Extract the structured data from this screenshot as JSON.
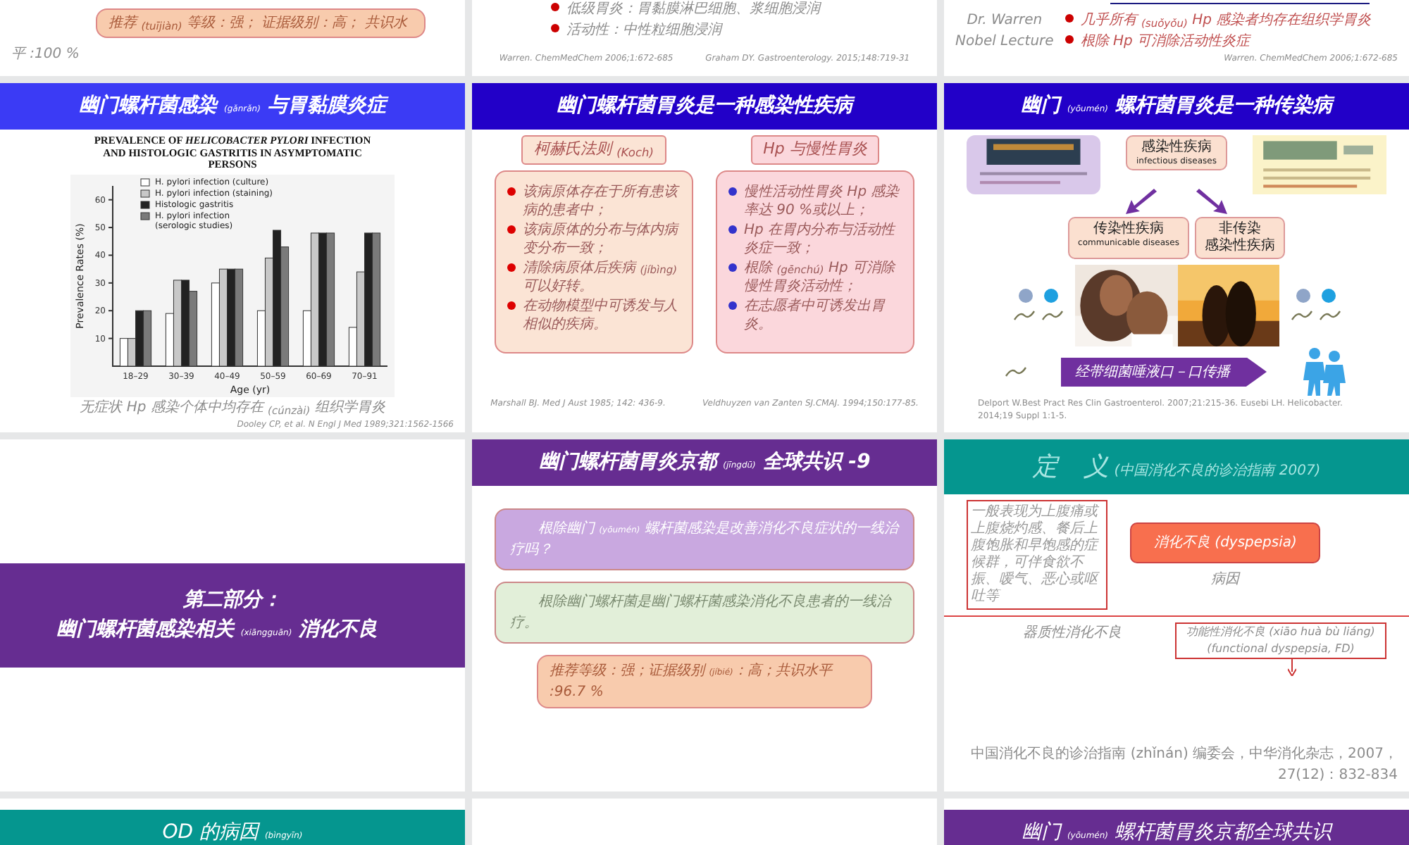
{
  "slides": [
    {
      "kind": "top-box",
      "box": "推荐 $_{(tuījiàn)}$ 等级：强； 证据级别：高； 共识水",
      "tail": "平 :100 %"
    },
    {
      "kind": "top-bullets",
      "bullets": [
        "低级胃炎：胃黏膜淋巴细胞、浆细胞浸润",
        "活动性：中性粒细胞浸润"
      ],
      "citations": [
        "Warren. ChemMedChem 2006;1:672-685",
        "Graham DY. Gastroenterology. 2015;148:719-31"
      ]
    },
    {
      "kind": "top-lecture",
      "color": "#1a1a80",
      "caption": [
        "Dr. Warren",
        "Nobel Lecture"
      ],
      "bullets": [
        "几乎所有 $_{(suǒyǒu)}$ Hp 感染者均存在组织学胃炎",
        "根除 Hp 可消除活动性炎症"
      ],
      "citations": [
        "Warren. ChemMedChem 2006;1:672-685"
      ]
    },
    {
      "kind": "chart",
      "color": "#3b3bf5",
      "title": "幽门螺杆菌感染 $_{(gǎnrǎn)}$ 与胃黏膜炎症",
      "chart_title": "PREVALENCE OF *HELICOBACTER PYLORI* INFECTION AND HISTOLOGIC GASTRITIS IN ASYMPTOMATIC PERSONS",
      "chart_data": {
        "type": "bar",
        "legend": "upper left",
        "xlabel": "Age (yr)",
        "ylabel": "Prevalence Rates (%)",
        "categories": [
          "18–29",
          "30–39",
          "40–49",
          "50–59",
          "60–69",
          "70–91"
        ],
        "ylim": [
          0,
          65
        ],
        "yticks": [
          10,
          20,
          30,
          40,
          50,
          60
        ],
        "series": [
          {
            "name": "H. pylori infection (culture)",
            "color": "#ffffff",
            "values": [
              10,
              19,
              30,
              20,
              20,
              14
            ]
          },
          {
            "name": "H. pylori infection (staining)",
            "color": "#c8c8c8",
            "values": [
              10,
              31,
              35,
              39,
              48,
              34
            ]
          },
          {
            "name": "Histologic gastritis",
            "color": "#222222",
            "values": [
              20,
              31,
              35,
              49,
              48,
              48
            ]
          },
          {
            "name": "H. pylori infection (serologic studies)",
            "color": "#7a7a7a",
            "values": [
              20,
              27,
              35,
              43,
              48,
              48
            ]
          }
        ]
      },
      "caption": "无症状 Hp 感染个体中均存在 $_{(cúnzài)}$ 组织学胃炎",
      "citation": "Dooley CP, et al. N Engl J Med 1989;321:1562-1566"
    },
    {
      "kind": "two-panel",
      "color": "#2200c8",
      "title": "幽门螺杆菌胃炎是一种感染性疾病",
      "panels": [
        {
          "label": "柯赫氏法则 $_{(Koch)}$",
          "color": "#dd0000",
          "bullets": [
            "该病原体存在于所有患该病的患者中；",
            "该病原体的分布与体内病变分布一致；",
            "清除病原体后疾病 $_{(jíbìng)}$ 可以好转。",
            "在动物模型中可诱发与人相似的疾病。"
          ]
        },
        {
          "label": "Hp 与慢性胃炎",
          "color": "#3333cc",
          "bullets": [
            "慢性活动性胃炎 Hp 感染率达 90 %或以上；",
            "Hp 在胃内分布与活动性炎症一致；",
            "根除 $_{(gēnchú)}$ Hp 可消除慢性胃炎活动性；",
            "在志愿者中可诱发出胃炎。"
          ]
        }
      ],
      "citations": [
        "Marshall BJ. Med J Aust 1985; 142: 436-9.",
        "Veldhuyzen van Zanten SJ.CMAJ. 1994;150:177-85."
      ]
    },
    {
      "kind": "diagram",
      "color": "#2200c8",
      "title": "幽门 $_{(yōumén)}$ 螺杆菌胃炎是一种传染病",
      "top": {
        "lines": [
          "感染性疾病"
        ],
        "subtitle": "infectious diseases"
      },
      "branches": [
        {
          "lines": [
            "传染性疾病"
          ],
          "subtitle": "communicable diseases"
        },
        {
          "lines": [
            "非传染",
            "感染性疾病"
          ]
        }
      ],
      "route": "经带细菌唾液口－口传播",
      "citation": "Delport W.Best Pract Res Clin Gastroenterol. 2007;21:215-36. Eusebi LH. Helicobacter. 2014;19 Suppl 1:1-5."
    },
    {
      "kind": "section",
      "color": "#662d91",
      "lines": [
        "第二部分：",
        "幽门螺杆菌感染相关 $_{(xiāngguān)}$ 消化不良"
      ]
    },
    {
      "kind": "consensus",
      "color": "#662d91",
      "title": "幽门螺杆菌胃炎京都 $_{(jīngdū)}$ 全球共识 -9",
      "boxes": [
        "根除幽门 $_{(yōumén)}$ 螺杆菌感染是改善消化不良症状的一线治疗吗？",
        "根除幽门螺杆菌是幽门螺杆菌感染消化不良患者的一线治疗。"
      ],
      "grade": "推荐等级：强；证据级别 $_{(jíbié)}$：高；共识水平 :96.7 %"
    },
    {
      "kind": "definition",
      "color": "#05968f",
      "title": "定　义",
      "subtitle": "(中国消化不良的诊治指南 2007)",
      "callout": "一般表现为上腹痛或上腹烧灼感、餐后上腹饱胀和早饱感的症候群，可伴食欲不振、嗳气、恶心或呕吐等",
      "main": "消化不良 (dyspepsia)",
      "cause": "病因",
      "branches": [
        "器质性消化不良",
        "功能性消化不良 (xiāo huà bù liáng) (functional dyspepsia, FD)"
      ],
      "citation": "中国消化不良的诊治指南 (zhǐnán) 编委会，中华消化杂志，2007，27(12)：832-834"
    },
    {
      "kind": "header-only",
      "color": "#05968f",
      "title": "OD 的病因 $_{(bìngyīn)}$"
    },
    {
      "kind": "blank"
    },
    {
      "kind": "header-only",
      "color": "#662d91",
      "title": "幽门 $_{(yōumén)}$ 螺杆菌胃炎京都全球共识"
    }
  ]
}
